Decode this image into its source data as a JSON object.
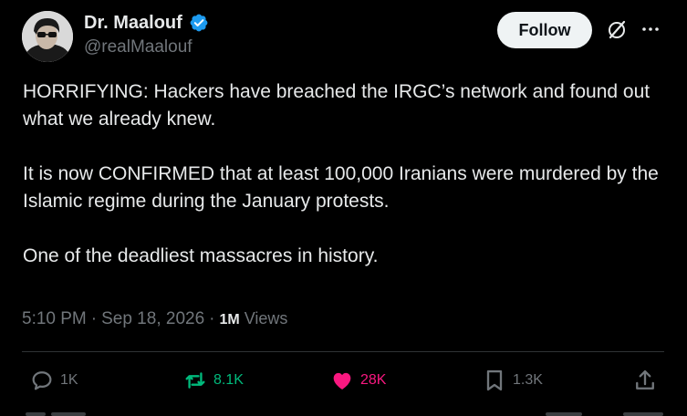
{
  "author": {
    "display_name": "Dr. Maalouf",
    "handle": "@realMaalouf",
    "verified": true,
    "avatar_icon": "profile-photo"
  },
  "header": {
    "follow_label": "Follow",
    "grok_icon": "grok-icon",
    "more_icon": "more-dots-icon"
  },
  "tweet": {
    "paragraphs": [
      "HORRIFYING: Hackers have breached the IRGC’s network and found out what we already knew.",
      "It is now CONFIRMED that at least 100,000 Iranians were murdered by the Islamic regime during the January protests.",
      "One of the deadliest massacres in history."
    ]
  },
  "meta": {
    "time": "5:10 PM",
    "separator1": "·",
    "date": "Sep 18, 2026",
    "separator2": "·",
    "views_count": "1M",
    "views_label": "Views"
  },
  "actions": {
    "reply": {
      "count": "1K",
      "icon": "reply-icon"
    },
    "retweet": {
      "count": "8.1K",
      "icon": "retweet-icon"
    },
    "like": {
      "count": "28K",
      "icon": "heart-icon",
      "liked": true
    },
    "bookmark": {
      "count": "1.3K",
      "icon": "bookmark-icon"
    },
    "share": {
      "icon": "share-icon"
    }
  },
  "colors": {
    "background": "#000000",
    "text_primary": "#e7e9ea",
    "text_secondary": "#71767b",
    "verified_blue": "#1d9bf0",
    "retweet_green": "#00ba7c",
    "like_pink": "#f91880",
    "divider": "#2f3336"
  }
}
